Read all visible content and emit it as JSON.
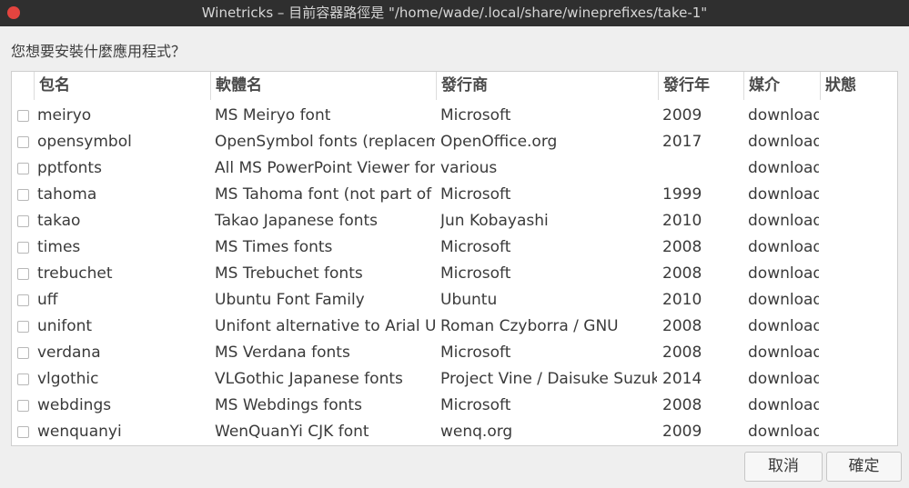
{
  "window": {
    "title": "Winetricks – 目前容器路徑是 \"/home/wade/.local/share/wineprefixes/take-1\""
  },
  "prompt": "您想要安裝什麼應用程式？",
  "columns": [
    "包名",
    "軟體名",
    "發行商",
    "發行年",
    "媒介",
    "狀態"
  ],
  "rows": [
    {
      "name": "meiryo",
      "title": "MS Meiryo font",
      "publisher": "Microsoft",
      "year": "2009",
      "media": "download"
    },
    {
      "name": "opensymbol",
      "title": "OpenSymbol fonts (replacement for Wingdings)",
      "publisher": "OpenOffice.org",
      "year": "2017",
      "media": "download"
    },
    {
      "name": "pptfonts",
      "title": "All MS PowerPoint Viewer fonts",
      "publisher": "various",
      "year": "",
      "media": "download"
    },
    {
      "name": "tahoma",
      "title": "MS Tahoma font (not part of core fonts)",
      "publisher": "Microsoft",
      "year": "1999",
      "media": "download"
    },
    {
      "name": "takao",
      "title": "Takao Japanese fonts",
      "publisher": "Jun Kobayashi",
      "year": "2010",
      "media": "download"
    },
    {
      "name": "times",
      "title": "MS Times fonts",
      "publisher": "Microsoft",
      "year": "2008",
      "media": "download"
    },
    {
      "name": "trebuchet",
      "title": "MS Trebuchet fonts",
      "publisher": "Microsoft",
      "year": "2008",
      "media": "download"
    },
    {
      "name": "uff",
      "title": "Ubuntu Font Family",
      "publisher": "Ubuntu",
      "year": "2010",
      "media": "download"
    },
    {
      "name": "unifont",
      "title": "Unifont alternative to Arial Unicode MS",
      "publisher": "Roman Czyborra / GNU",
      "year": "2008",
      "media": "download"
    },
    {
      "name": "verdana",
      "title": "MS Verdana fonts",
      "publisher": "Microsoft",
      "year": "2008",
      "media": "download"
    },
    {
      "name": "vlgothic",
      "title": "VLGothic Japanese fonts",
      "publisher": "Project Vine / Daisuke Suzuki",
      "year": "2014",
      "media": "download"
    },
    {
      "name": "webdings",
      "title": "MS Webdings fonts",
      "publisher": "Microsoft",
      "year": "2008",
      "media": "download"
    },
    {
      "name": "wenquanyi",
      "title": "WenQuanYi CJK font",
      "publisher": "wenq.org",
      "year": "2009",
      "media": "download"
    }
  ],
  "buttons": {
    "cancel": "取消",
    "ok": "確定"
  },
  "colors": {
    "titlebar": "#2f2f2f",
    "close": "#e3443f",
    "background": "#efefef"
  }
}
